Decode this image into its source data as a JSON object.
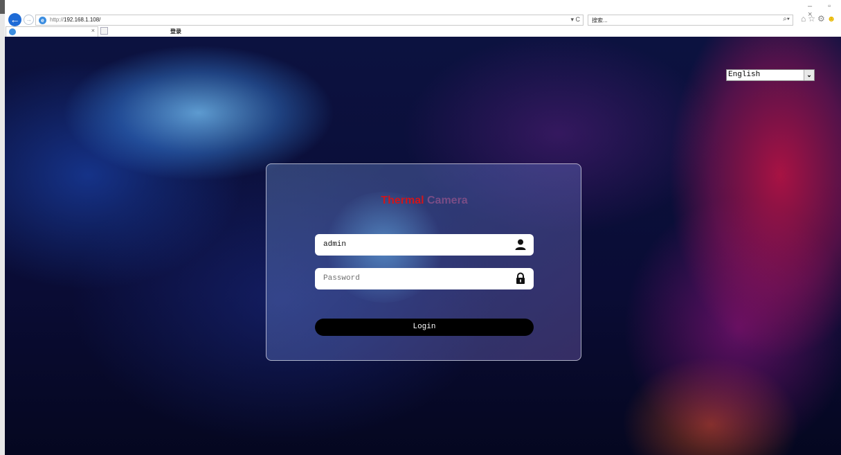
{
  "browser": {
    "url_prefix": "http://",
    "url_host": "192.168.1.108/",
    "address_controls": "▾ C",
    "search_placeholder": "搜索...",
    "search_icon_glyph": "⌕▾",
    "tab_title": "登录",
    "tab_close": "×",
    "window_controls": "– ▫ ×",
    "back_glyph": "←",
    "forward_glyph": "→"
  },
  "page": {
    "language": "English",
    "language_arrow": "⌄",
    "title_part1": "Thermal",
    "title_part2": "Camera",
    "username_value": "admin",
    "password_placeholder": "Password",
    "login_label": "Login"
  },
  "colors": {
    "title_thermal": "#d0151b",
    "title_camera": "#7a4d86",
    "login_button": "#000000"
  },
  "icons": [
    "user-icon",
    "lock-icon",
    "home-icon",
    "star-icon",
    "gear-icon",
    "smiley-icon"
  ]
}
